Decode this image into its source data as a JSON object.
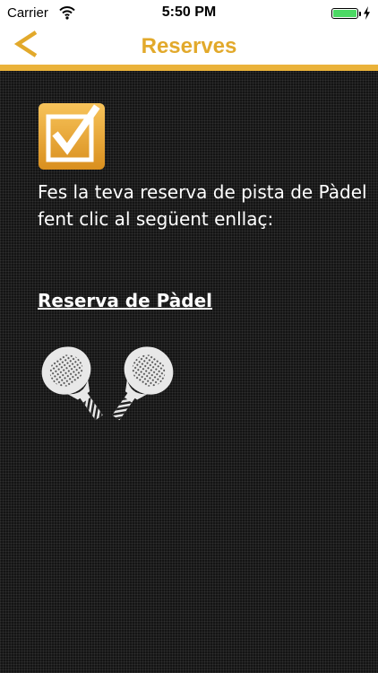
{
  "status_bar": {
    "carrier": "Carrier",
    "time": "5:50 PM",
    "icons": [
      "wifi-icon",
      "battery-icon",
      "charging-bolt-icon"
    ]
  },
  "nav": {
    "back_icon": "chevron-left-icon",
    "title": "Reserves"
  },
  "content": {
    "header_icon": "checkbox-checked-icon",
    "intro": "Fes la teva reserva de pista de Pàdel fent clic al següent enllaç:",
    "link_label": "Reserva de Pàdel",
    "illustration_icon": "padel-rackets-icon"
  },
  "colors": {
    "accent": "#eab23a",
    "title": "#e2a92b",
    "background": "#141414",
    "text": "#ffffff",
    "battery": "#4cd964"
  }
}
